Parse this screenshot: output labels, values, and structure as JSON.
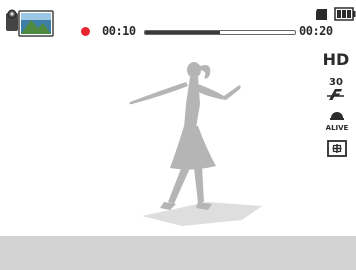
{
  "status": {
    "mode_icon": "movie-mode-icon",
    "recording_indicator": "recording-dot",
    "recording_color": "#e8252f",
    "elapsed_time": "00:10",
    "total_time": "00:20",
    "progress_fraction": 0.5,
    "storage_icon": "memory-card-icon",
    "battery_icon": "battery-full-icon"
  },
  "settings": {
    "resolution_label": "HD",
    "frame_rate_icon": "30fps-icon",
    "voice_icon": "alive-voice-icon",
    "metering_icon": "metering-icon"
  },
  "scene": {
    "subject": "dancing-woman-silhouette"
  }
}
